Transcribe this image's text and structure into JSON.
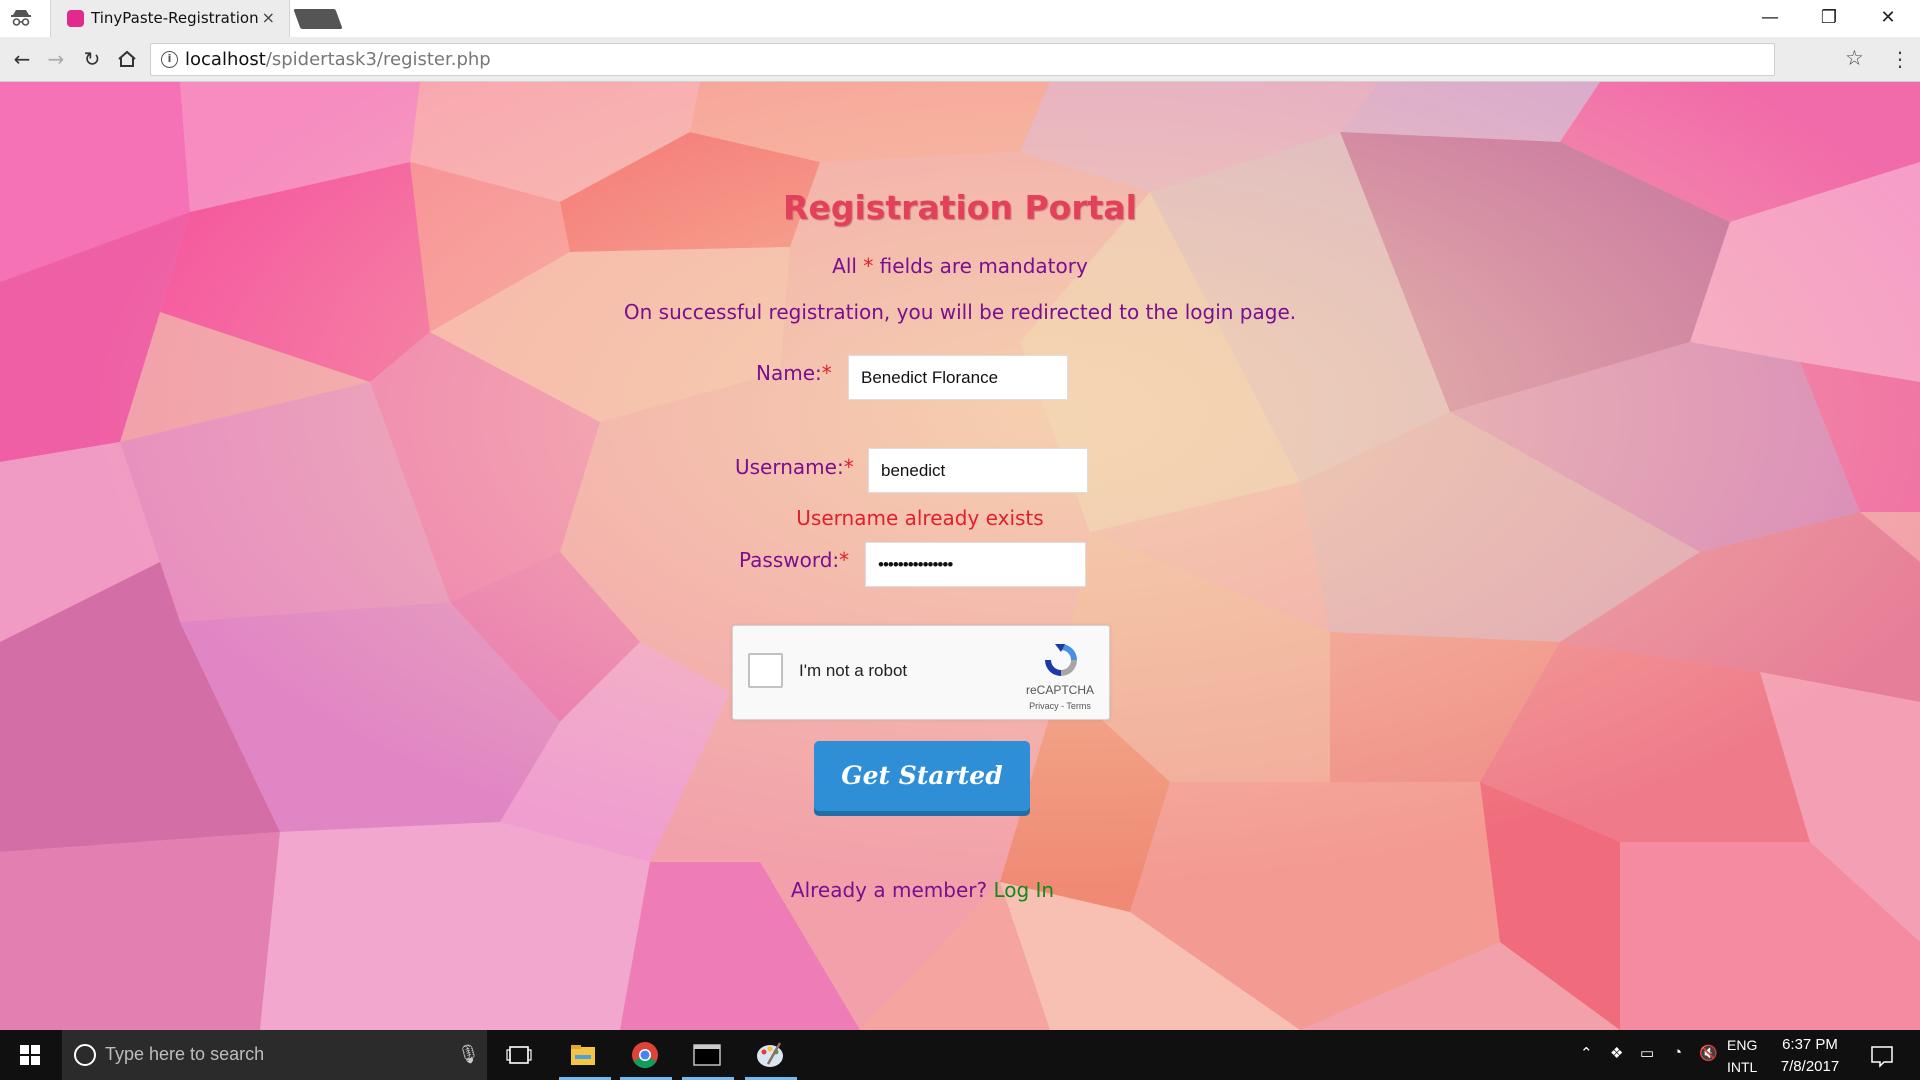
{
  "browser": {
    "tab_title": "TinyPaste-Registration",
    "tab_close": "×",
    "url_host": "localhost",
    "url_path": "/spidertask3/register.php",
    "window_controls": [
      "—",
      "❐",
      "✕"
    ]
  },
  "page": {
    "title": "Registration Portal",
    "mandatory_note_prefix": "All ",
    "mandatory_star": "*",
    "mandatory_note_suffix": " fields are mandatory",
    "redirect_note": "On successful registration, you will be redirected to the login page.",
    "name_label": "Name:",
    "name_value": "Benedict Florance",
    "username_label": "Username:",
    "username_value": "benedict",
    "username_error": "Username already exists",
    "password_label": "Password:",
    "password_value": "•••••••••••••••",
    "required_marker": "*",
    "captcha_label": "I'm not a robot",
    "captcha_brand": "reCAPTCHA",
    "captcha_links": "Privacy - Terms",
    "submit_label": "Get Started",
    "member_prompt": "Already a member? ",
    "login_link": "Log In",
    "colors": {
      "title": "#e3405b",
      "text": "#7a0f8f",
      "error": "#e0202c",
      "button": "#2f8fd6",
      "link": "#128a1c"
    }
  },
  "taskbar": {
    "search_placeholder": "Type here to search",
    "lang_top": "ENG",
    "lang_bottom": "INTL",
    "time": "6:37 PM",
    "date": "7/8/2017",
    "apps": [
      "task-view-icon",
      "file-explorer-icon",
      "chrome-icon",
      "terminal-icon",
      "paint-icon"
    ]
  }
}
